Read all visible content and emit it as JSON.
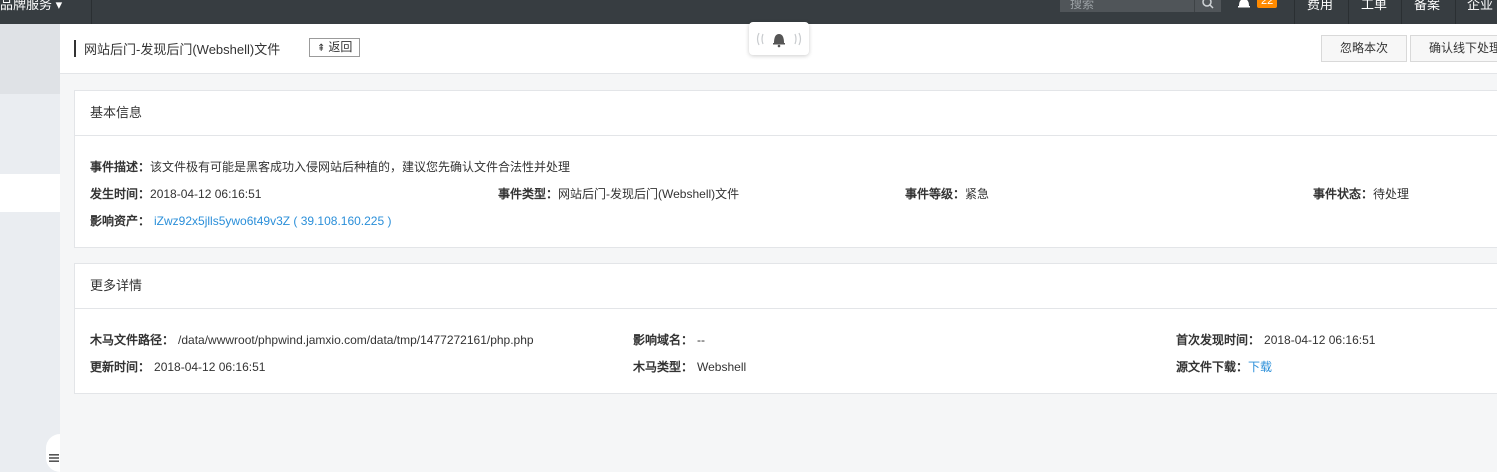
{
  "topbar": {
    "service_label": "品牌服务 ▾",
    "search_placeholder": "搜索",
    "notification_count": "22",
    "items": [
      "费用",
      "工单",
      "备案",
      "企业"
    ]
  },
  "header": {
    "title": "网站后门-发现后门(Webshell)文件",
    "back_label": "返回",
    "ignore_label": "忽略本次",
    "confirm_label": "确认线下处理"
  },
  "basic_info": {
    "heading": "基本信息",
    "description_label": "事件描述：",
    "description_value": "该文件极有可能是黑客成功入侵网站后种植的，建议您先确认文件合法性并处理",
    "time_label": "发生时间：",
    "time_value": "2018-04-12 06:16:51",
    "type_label": "事件类型：",
    "type_value": "网站后门-发现后门(Webshell)文件",
    "level_label": "事件等级：",
    "level_value": "紧急",
    "status_label": "事件状态：",
    "status_value": "待处理",
    "asset_label": "影响资产：",
    "asset_value": "iZwz92x5jlls5ywo6t49v3Z ( 39.108.160.225 )"
  },
  "more_details": {
    "heading": "更多详情",
    "path_label": "木马文件路径：",
    "path_value": "/data/wwwroot/phpwind.jamxio.com/data/tmp/1477272161/php.php",
    "domain_label": "影响域名：",
    "domain_value": "--",
    "first_found_label": "首次发现时间：",
    "first_found_value": "2018-04-12 06:16:51",
    "updated_label": "更新时间：",
    "updated_value": "2018-04-12 06:16:51",
    "trojan_type_label": "木马类型：",
    "trojan_type_value": "Webshell",
    "download_label": "源文件下载：",
    "download_link": "下载"
  },
  "colors": {
    "topbar": "#373d41",
    "link": "#2b8fd9",
    "badge": "#ff8a00"
  }
}
